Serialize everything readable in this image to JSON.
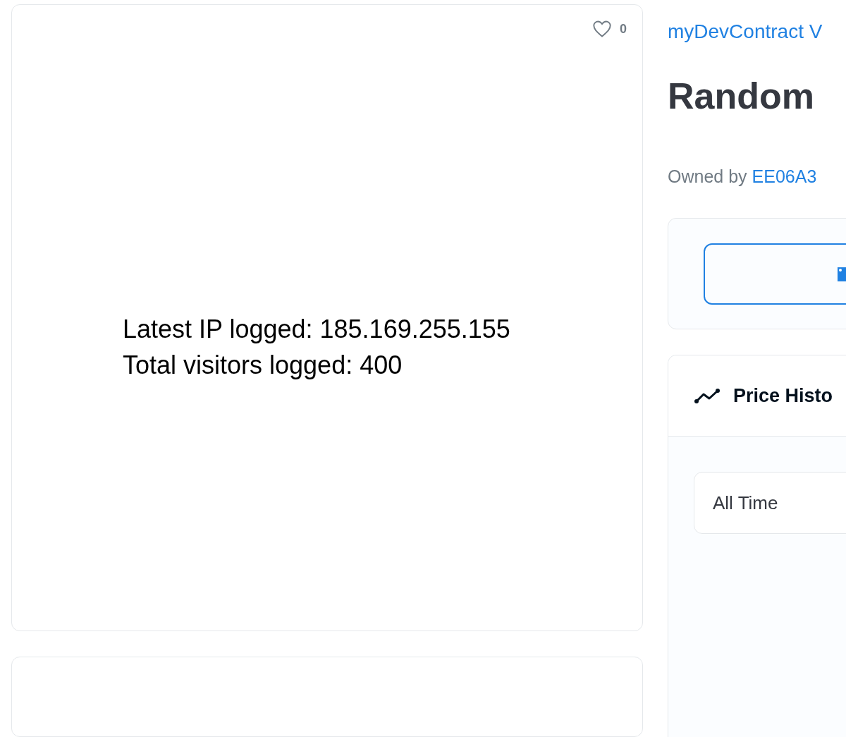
{
  "like": {
    "count": "0",
    "liked": false
  },
  "media": {
    "lines": [
      "Latest IP logged: 185.169.255.155",
      "Total visitors logged: 400"
    ]
  },
  "collection": {
    "name": "myDevContract V"
  },
  "title": "Random",
  "owner": {
    "label": "Owned by",
    "name": "EE06A3"
  },
  "price_history": {
    "title": "Price Histo",
    "period": "All Time"
  }
}
